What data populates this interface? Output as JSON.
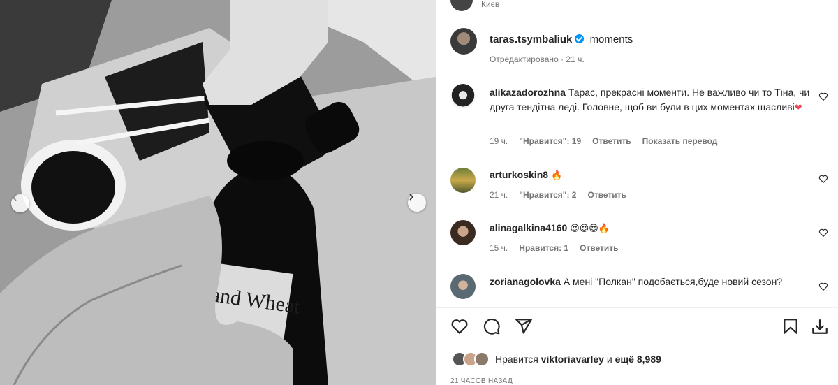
{
  "photo": {
    "label_text": "Island Wheat",
    "prev_icon": "chevron-left-icon",
    "next_icon": "chevron-right-icon"
  },
  "header": {
    "partial_caption": "Києв",
    "username": "taras.tsymbaliuk",
    "verified": true,
    "caption": "moments",
    "edited": "Отредактировано",
    "time": "21 ч."
  },
  "comments": [
    {
      "username": "alikazadorozhna",
      "text": "Тарас, прекрасні моменти. Не важливо чи то Тіна, чи друга тендітна леді. Головне, щоб ви були в цих моментах щасливі",
      "emoji": "❤",
      "time": "19 ч.",
      "likes": "\"Нравится\": 19",
      "reply": "Ответить",
      "translate": "Показать перевод"
    },
    {
      "username": "arturkoskin8",
      "text": "",
      "emoji": "🔥",
      "time": "21 ч.",
      "likes": "\"Нравится\": 2",
      "reply": "Ответить"
    },
    {
      "username": "alinagalkina4160",
      "text": "",
      "emoji": "😍😍😍🔥",
      "time": "15 ч.",
      "likes": "Нравится: 1",
      "reply": "Ответить"
    },
    {
      "username": "zorianagolovka",
      "text": "А мені \"Полкан\" подобається,буде новий сезон?",
      "emoji": ""
    }
  ],
  "footer": {
    "likes_prefix": "Нравится",
    "likes_user": "viktoriavarley",
    "likes_and": "и",
    "likes_more": "ещё 8,989",
    "timestamp": "21 ЧАСОВ НАЗАД"
  },
  "colors": {
    "text": "#262626",
    "secondary": "#737373",
    "verified": "#0095f6",
    "heart": "#ed4956"
  }
}
